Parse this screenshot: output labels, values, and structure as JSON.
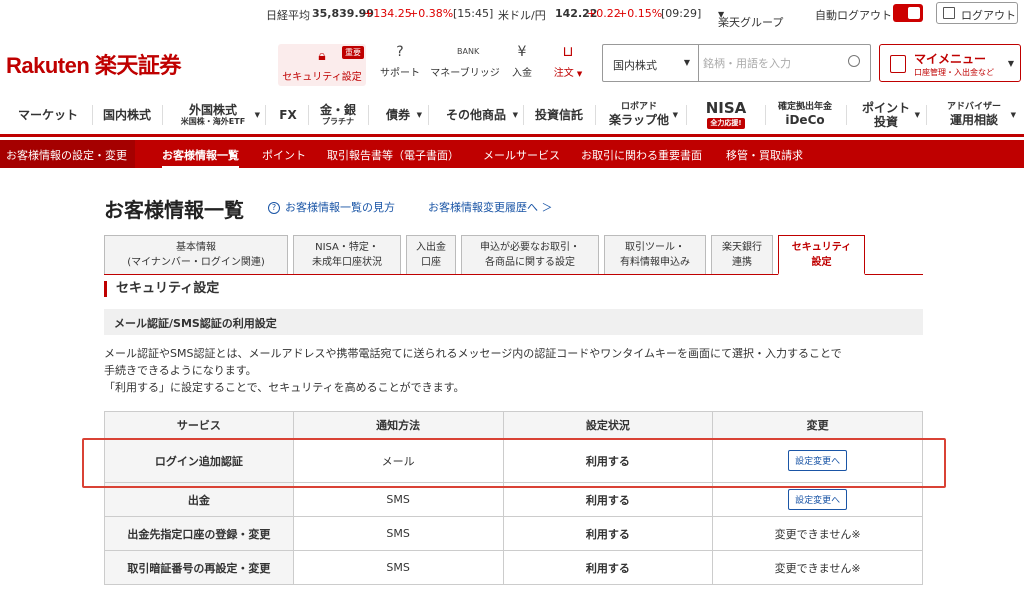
{
  "ticker": {
    "nikkei_label": "日経平均",
    "nikkei_value": "35,839.99",
    "nikkei_change": "+134.25",
    "nikkei_pct": "+0.38%",
    "nikkei_time": "[15:45]",
    "usd_label": "米ドル/円",
    "usd_value": "142.22",
    "usd_change": "+0.22",
    "usd_pct": "+0.15%",
    "usd_time": "[09:29]",
    "group_label": "楽天グループ",
    "auto_logout_label": "自動ログアウト",
    "logout_label": "ログアウト"
  },
  "header": {
    "logo_text": "Rakuten 楽天証券",
    "util": [
      {
        "label": "セキュリティ設定",
        "icon": "lock-icon",
        "badge": "重要"
      },
      {
        "label": "サポート",
        "icon": "chat-icon"
      },
      {
        "label": "マネーブリッジ",
        "icon": "bank-icon"
      },
      {
        "label": "入金",
        "icon": "coin-icon"
      },
      {
        "label": "注文",
        "icon": "cart-icon"
      }
    ],
    "search_select": "国内株式",
    "search_placeholder": "銘柄・用語を入力",
    "mymenu_title": "マイメニュー",
    "mymenu_sub": "口座管理・入出金など"
  },
  "mainnav": [
    {
      "label": "マーケット",
      "sub": ""
    },
    {
      "label": "国内株式",
      "sub": ""
    },
    {
      "label": "外国株式",
      "sub": "米国株・海外ETF"
    },
    {
      "label": "FX",
      "sub": ""
    },
    {
      "label": "金・銀",
      "sub": "プラチナ"
    },
    {
      "label": "債券",
      "sub": ""
    },
    {
      "label": "その他商品",
      "sub": ""
    },
    {
      "label": "投資信託",
      "sub": ""
    },
    {
      "label": "ロボアド",
      "sub": "楽ラップ他"
    },
    {
      "label": "NISA",
      "sub": "全力応援!"
    },
    {
      "label": "確定拠出年金",
      "sub": "iDeCo"
    },
    {
      "label": "ポイント",
      "sub": "投資"
    },
    {
      "label": "アドバイザー",
      "sub": "運用相談"
    }
  ],
  "subnav": [
    "お客様情報の設定・変更",
    "お客様情報一覧",
    "ポイント",
    "取引報告書等（電子書面）",
    "メールサービス",
    "お取引に関わる重要書面",
    "移管・買取請求"
  ],
  "page": {
    "title": "お客様情報一覧",
    "link_howto": "お客様情報一覧の見方",
    "link_history": "お客様情報変更履歴へ ＞"
  },
  "tabs": [
    {
      "l1": "基本情報",
      "l2": "(マイナンバー・ログイン関連)"
    },
    {
      "l1": "NISA・特定・",
      "l2": "未成年口座状況"
    },
    {
      "l1": "入出金",
      "l2": "口座"
    },
    {
      "l1": "申込が必要なお取引・",
      "l2": "各商品に関する設定"
    },
    {
      "l1": "取引ツール・",
      "l2": "有料情報申込み"
    },
    {
      "l1": "楽天銀行",
      "l2": "連携"
    },
    {
      "l1": "セキュリティ",
      "l2": "設定"
    }
  ],
  "section_title": "セキュリティ設定",
  "subsection_title": "メール認証/SMS認証の利用設定",
  "description": {
    "line1": "メール認証やSMS認証とは、メールアドレスや携帯電話宛てに送られるメッセージ内の認証コードやワンタイムキーを画面にて選択・入力することで",
    "line2": "手続きできるようになります。",
    "line3": "「利用する」に設定することで、セキュリティを高めることができます。"
  },
  "table": {
    "headers": [
      "サービス",
      "通知方法",
      "設定状況",
      "変更"
    ],
    "rows": [
      {
        "service": "ログイン追加認証",
        "method": "メール",
        "status": "利用する",
        "change": "設定変更へ",
        "button": true
      },
      {
        "service": "出金",
        "method": "SMS",
        "status": "利用する",
        "change": "設定変更へ",
        "button": true
      },
      {
        "service": "出金先指定口座の登録・変更",
        "method": "SMS",
        "status": "利用する",
        "change": "変更できません※",
        "button": false
      },
      {
        "service": "取引暗証番号の再設定・変更",
        "method": "SMS",
        "status": "利用する",
        "change": "変更できません※",
        "button": false
      }
    ]
  },
  "colors": {
    "brand": "#bf0000",
    "link": "#1a55a6",
    "highlight": "#d94235"
  }
}
